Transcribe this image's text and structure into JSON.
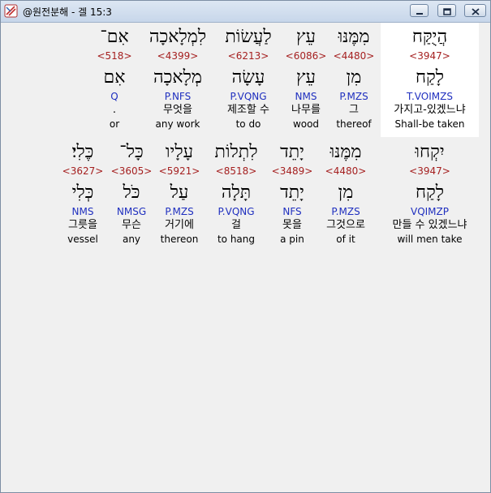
{
  "window": {
    "title": "@원전분해 - 겔 15:3",
    "minimize_icon": "minimize-icon",
    "maximize_icon": "maximize-icon",
    "close_icon": "close-icon",
    "app_icon": "app-logo-icon"
  },
  "colors": {
    "strong": "#a52020",
    "parse": "#1f2fbf",
    "highlight": "#ffffff"
  },
  "rows": [
    {
      "words": [
        {
          "hebrew": "אִם־",
          "strong": "<518>",
          "lemma": "אִם",
          "parse": "Q",
          "korean": ".",
          "english": "or"
        },
        {
          "hebrew": "לִמְלָאכָה",
          "strong": "<4399>",
          "lemma": "מְלָאכָה",
          "parse": "P.NFS",
          "korean": "무엇을",
          "english": "any work"
        },
        {
          "hebrew": "לַעֲשׂוֹת",
          "strong": "<6213>",
          "lemma": "עָשָׂה",
          "parse": "P.VQNG",
          "korean": "제조할 수",
          "english": "to do"
        },
        {
          "hebrew": "עֵץ",
          "strong": "<6086>",
          "lemma": "עֵץ",
          "parse": "NMS",
          "korean": "나무를",
          "english": "wood"
        },
        {
          "hebrew": "מִמֶּנּוּ",
          "strong": "<4480>",
          "lemma": "מִן",
          "parse": "P.MZS",
          "korean": "그",
          "english": "thereof"
        },
        {
          "hebrew": "הֲיֻקַּח",
          "strong": "<3947>",
          "lemma": "לָקַח",
          "parse": "T.VOIMZS",
          "korean": "가지고-있겠느냐",
          "english": "Shall-be taken"
        }
      ]
    },
    {
      "words": [
        {
          "hebrew": "כֶּלִי׃",
          "strong": "<3627>",
          "lemma": "כְּלִי",
          "parse": "NMS",
          "korean": "그릇을",
          "english": "vessel"
        },
        {
          "hebrew": "כָּל־",
          "strong": "<3605>",
          "lemma": "כֹּל",
          "parse": "NMSG",
          "korean": "무슨",
          "english": "any"
        },
        {
          "hebrew": "עָלָיו",
          "strong": "<5921>",
          "lemma": "עַל",
          "parse": "P.MZS",
          "korean": "거기에",
          "english": "thereon"
        },
        {
          "hebrew": "לִתְלוֹת",
          "strong": "<8518>",
          "lemma": "תָּלָה",
          "parse": "P.VQNG",
          "korean": "걸",
          "english": "to hang"
        },
        {
          "hebrew": "יָתֵד",
          "strong": "<3489>",
          "lemma": "יָתֵד",
          "parse": "NFS",
          "korean": "못을",
          "english": "a pin"
        },
        {
          "hebrew": "מִמֶּנּוּ",
          "strong": "<4480>",
          "lemma": "מִן",
          "parse": "P.MZS",
          "korean": "그것으로",
          "english": "of it"
        },
        {
          "hebrew": "יִקְחוּ",
          "strong": "<3947>",
          "lemma": "לָקַח",
          "parse": "VQIMZP",
          "korean": "만들 수 있겠느냐",
          "english": "will men take"
        }
      ]
    }
  ]
}
